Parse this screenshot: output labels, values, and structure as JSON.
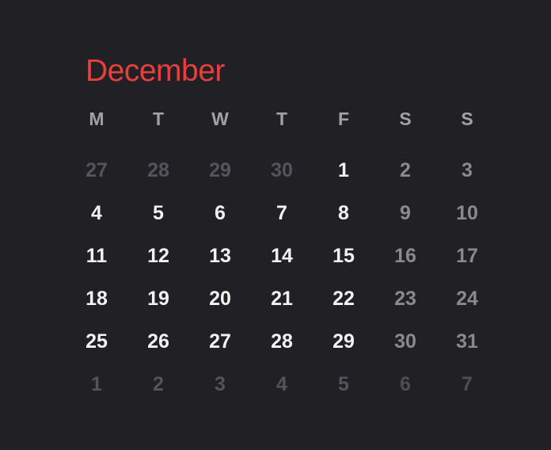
{
  "calendar": {
    "month": "December",
    "accent_color": "#E5403E",
    "weekdays": [
      "M",
      "T",
      "W",
      "T",
      "F",
      "S",
      "S"
    ],
    "weeks": [
      [
        {
          "label": "27",
          "state": "adjacent"
        },
        {
          "label": "28",
          "state": "adjacent"
        },
        {
          "label": "29",
          "state": "adjacent"
        },
        {
          "label": "30",
          "state": "adjacent"
        },
        {
          "label": "1",
          "state": "current"
        },
        {
          "label": "2",
          "state": "current"
        },
        {
          "label": "3",
          "state": "current"
        }
      ],
      [
        {
          "label": "4",
          "state": "current"
        },
        {
          "label": "5",
          "state": "current"
        },
        {
          "label": "6",
          "state": "current"
        },
        {
          "label": "7",
          "state": "current"
        },
        {
          "label": "8",
          "state": "current"
        },
        {
          "label": "9",
          "state": "current"
        },
        {
          "label": "10",
          "state": "current"
        }
      ],
      [
        {
          "label": "11",
          "state": "current"
        },
        {
          "label": "12",
          "state": "current"
        },
        {
          "label": "13",
          "state": "current"
        },
        {
          "label": "14",
          "state": "current"
        },
        {
          "label": "15",
          "state": "current"
        },
        {
          "label": "16",
          "state": "current"
        },
        {
          "label": "17",
          "state": "current"
        }
      ],
      [
        {
          "label": "18",
          "state": "current"
        },
        {
          "label": "19",
          "state": "current"
        },
        {
          "label": "20",
          "state": "current"
        },
        {
          "label": "21",
          "state": "current"
        },
        {
          "label": "22",
          "state": "current"
        },
        {
          "label": "23",
          "state": "current"
        },
        {
          "label": "24",
          "state": "current"
        }
      ],
      [
        {
          "label": "25",
          "state": "current"
        },
        {
          "label": "26",
          "state": "current"
        },
        {
          "label": "27",
          "state": "current"
        },
        {
          "label": "28",
          "state": "current"
        },
        {
          "label": "29",
          "state": "current"
        },
        {
          "label": "30",
          "state": "current"
        },
        {
          "label": "31",
          "state": "current"
        }
      ],
      [
        {
          "label": "1",
          "state": "adjacent"
        },
        {
          "label": "2",
          "state": "adjacent"
        },
        {
          "label": "3",
          "state": "adjacent"
        },
        {
          "label": "4",
          "state": "adjacent"
        },
        {
          "label": "5",
          "state": "adjacent"
        },
        {
          "label": "6",
          "state": "adjacent"
        },
        {
          "label": "7",
          "state": "adjacent"
        }
      ]
    ]
  }
}
